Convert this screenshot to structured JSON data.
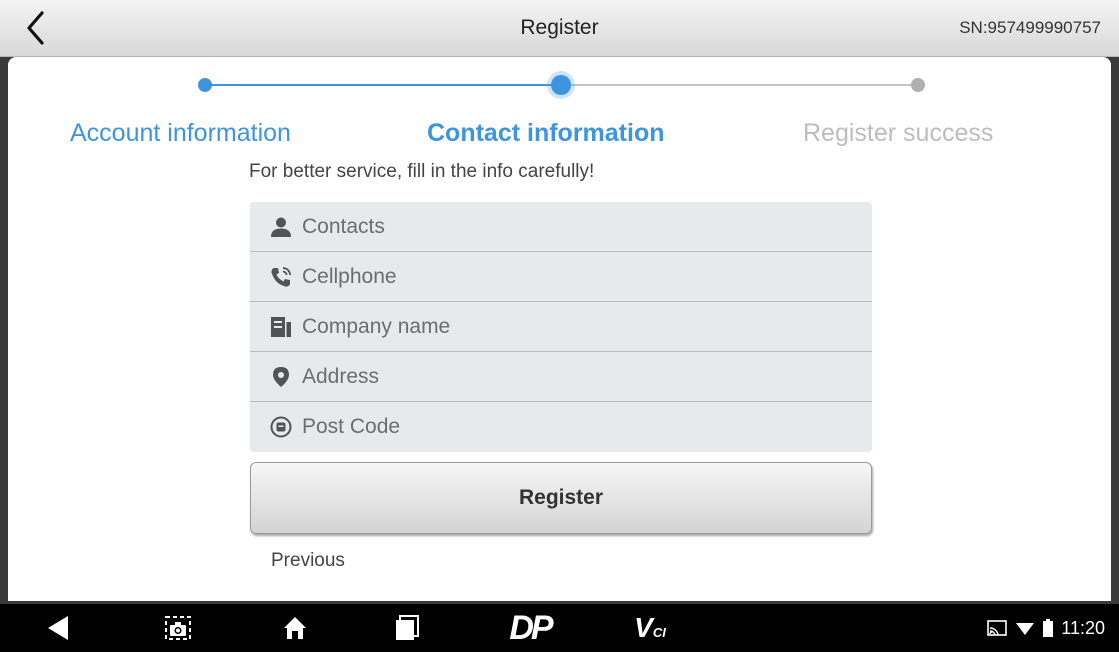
{
  "header": {
    "title": "Register",
    "serial": "SN:957499990757",
    "back_icon": "chevron-left-icon"
  },
  "steps": [
    {
      "label": "Account information",
      "state": "done"
    },
    {
      "label": "Contact information",
      "state": "active"
    },
    {
      "label": "Register success",
      "state": "pending"
    }
  ],
  "subtitle": "For better service, fill in the info carefully!",
  "form": {
    "fields": [
      {
        "placeholder": "Contacts",
        "value": "",
        "icon": "person-icon"
      },
      {
        "placeholder": "Cellphone",
        "value": "",
        "icon": "phone-icon"
      },
      {
        "placeholder": "Company name",
        "value": "",
        "icon": "building-icon"
      },
      {
        "placeholder": "Address",
        "value": "",
        "icon": "location-pin-icon"
      },
      {
        "placeholder": "Post Code",
        "value": "",
        "icon": "mailbox-icon"
      }
    ]
  },
  "actions": {
    "register_label": "Register",
    "previous_label": "Previous"
  },
  "navbar": {
    "items": [
      "back-icon",
      "screenshot-icon",
      "home-icon",
      "recent-apps-icon",
      "dp-logo",
      "vci-logo"
    ],
    "logo_dp": "DP",
    "logo_vci": "V",
    "logo_vci_sub": "CI"
  },
  "status": {
    "time": "11:20",
    "icons": [
      "cast-icon",
      "wifi-icon",
      "battery-icon"
    ]
  },
  "colors": {
    "accent": "#3d95e0",
    "inactive": "#bdbdbd",
    "form_bg": "#e7eaeb"
  }
}
